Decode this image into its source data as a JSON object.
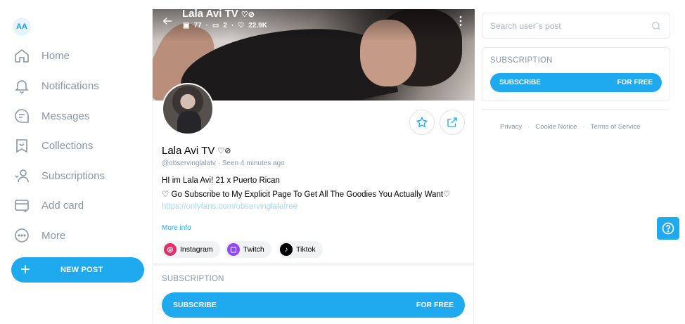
{
  "sidebar": {
    "avatar_initials": "AA",
    "items": [
      {
        "label": "Home",
        "icon": "home-icon"
      },
      {
        "label": "Notifications",
        "icon": "bell-icon"
      },
      {
        "label": "Messages",
        "icon": "message-icon"
      },
      {
        "label": "Collections",
        "icon": "bookmark-icon"
      },
      {
        "label": "Subscriptions",
        "icon": "subscriptions-icon"
      },
      {
        "label": "Add card",
        "icon": "card-icon"
      },
      {
        "label": "More",
        "icon": "more-icon"
      }
    ],
    "new_post_label": "NEW POST"
  },
  "profile": {
    "cover_name": "Lala Avi TV",
    "stats": {
      "photos": "77",
      "videos": "2",
      "likes": "22.9K"
    },
    "name": "Lala Avi TV",
    "handle": "@observinglalatv",
    "seen_separator": "·",
    "seen": "Seen  4 minutes ago",
    "bio_line1": "HI im Lala Avi! 21 x Puerto Rican",
    "bio_line2": "♡ Go Subscribe to My Explicit Page To Get All The Goodies You Actually Want♡",
    "bio_link": "https://onlyfans.com/observinglalafree",
    "more_info": "More info",
    "socials": [
      {
        "label": "Instagram",
        "icon": "instagram-icon",
        "color": "#e1306c"
      },
      {
        "label": "Twitch",
        "icon": "twitch-icon",
        "color": "#9146ff"
      },
      {
        "label": "Tiktok",
        "icon": "tiktok-icon",
        "color": "#000000"
      }
    ]
  },
  "subscription_main": {
    "title": "SUBSCRIPTION",
    "button_left": "SUBSCRIBE",
    "button_right": "FOR FREE"
  },
  "right": {
    "search_placeholder": "Search user`s post",
    "subscription": {
      "title": "SUBSCRIPTION",
      "button_left": "SUBSCRIBE",
      "button_right": "FOR FREE"
    },
    "footer": {
      "privacy": "Privacy",
      "cookie": "Cookie Notice",
      "terms": "Terms of Service",
      "separator": "·"
    }
  },
  "colors": {
    "accent": "#1faaf0",
    "muted": "#8a96a3"
  }
}
